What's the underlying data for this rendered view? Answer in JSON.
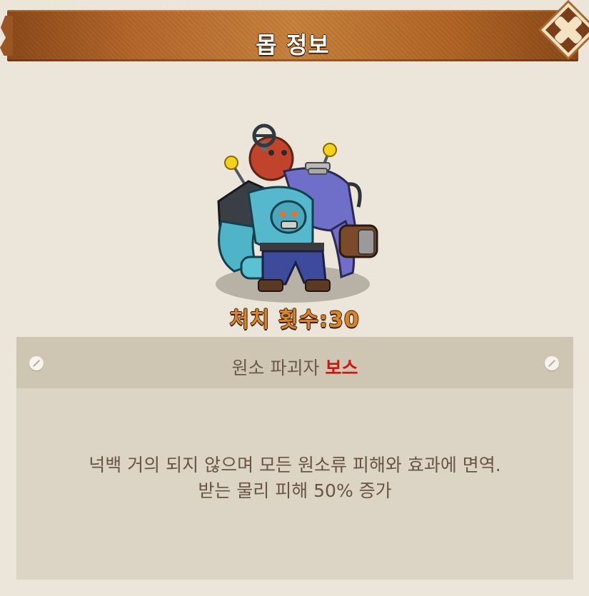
{
  "header": {
    "title": "몹 정보",
    "close_icon": "close-x-icon"
  },
  "monster": {
    "portrait": "monster-portrait",
    "kill_count": "처치 횟수:30"
  },
  "info": {
    "name": "원소 파괴자",
    "type": "보스",
    "description_line1": "넉백 거의 되지 않으며 모든 원소류 피해와 효과에 면역.",
    "description_line2": "받는 물리 피해 50% 증가",
    "pin_icon": "pin-icon"
  },
  "colors": {
    "background": "#ece6da",
    "banner": "#b6672c",
    "kill_count": "#d8842a",
    "boss_label": "#d0140e",
    "panel": "#dcd5c5",
    "panel_header": "#cec6b2"
  }
}
